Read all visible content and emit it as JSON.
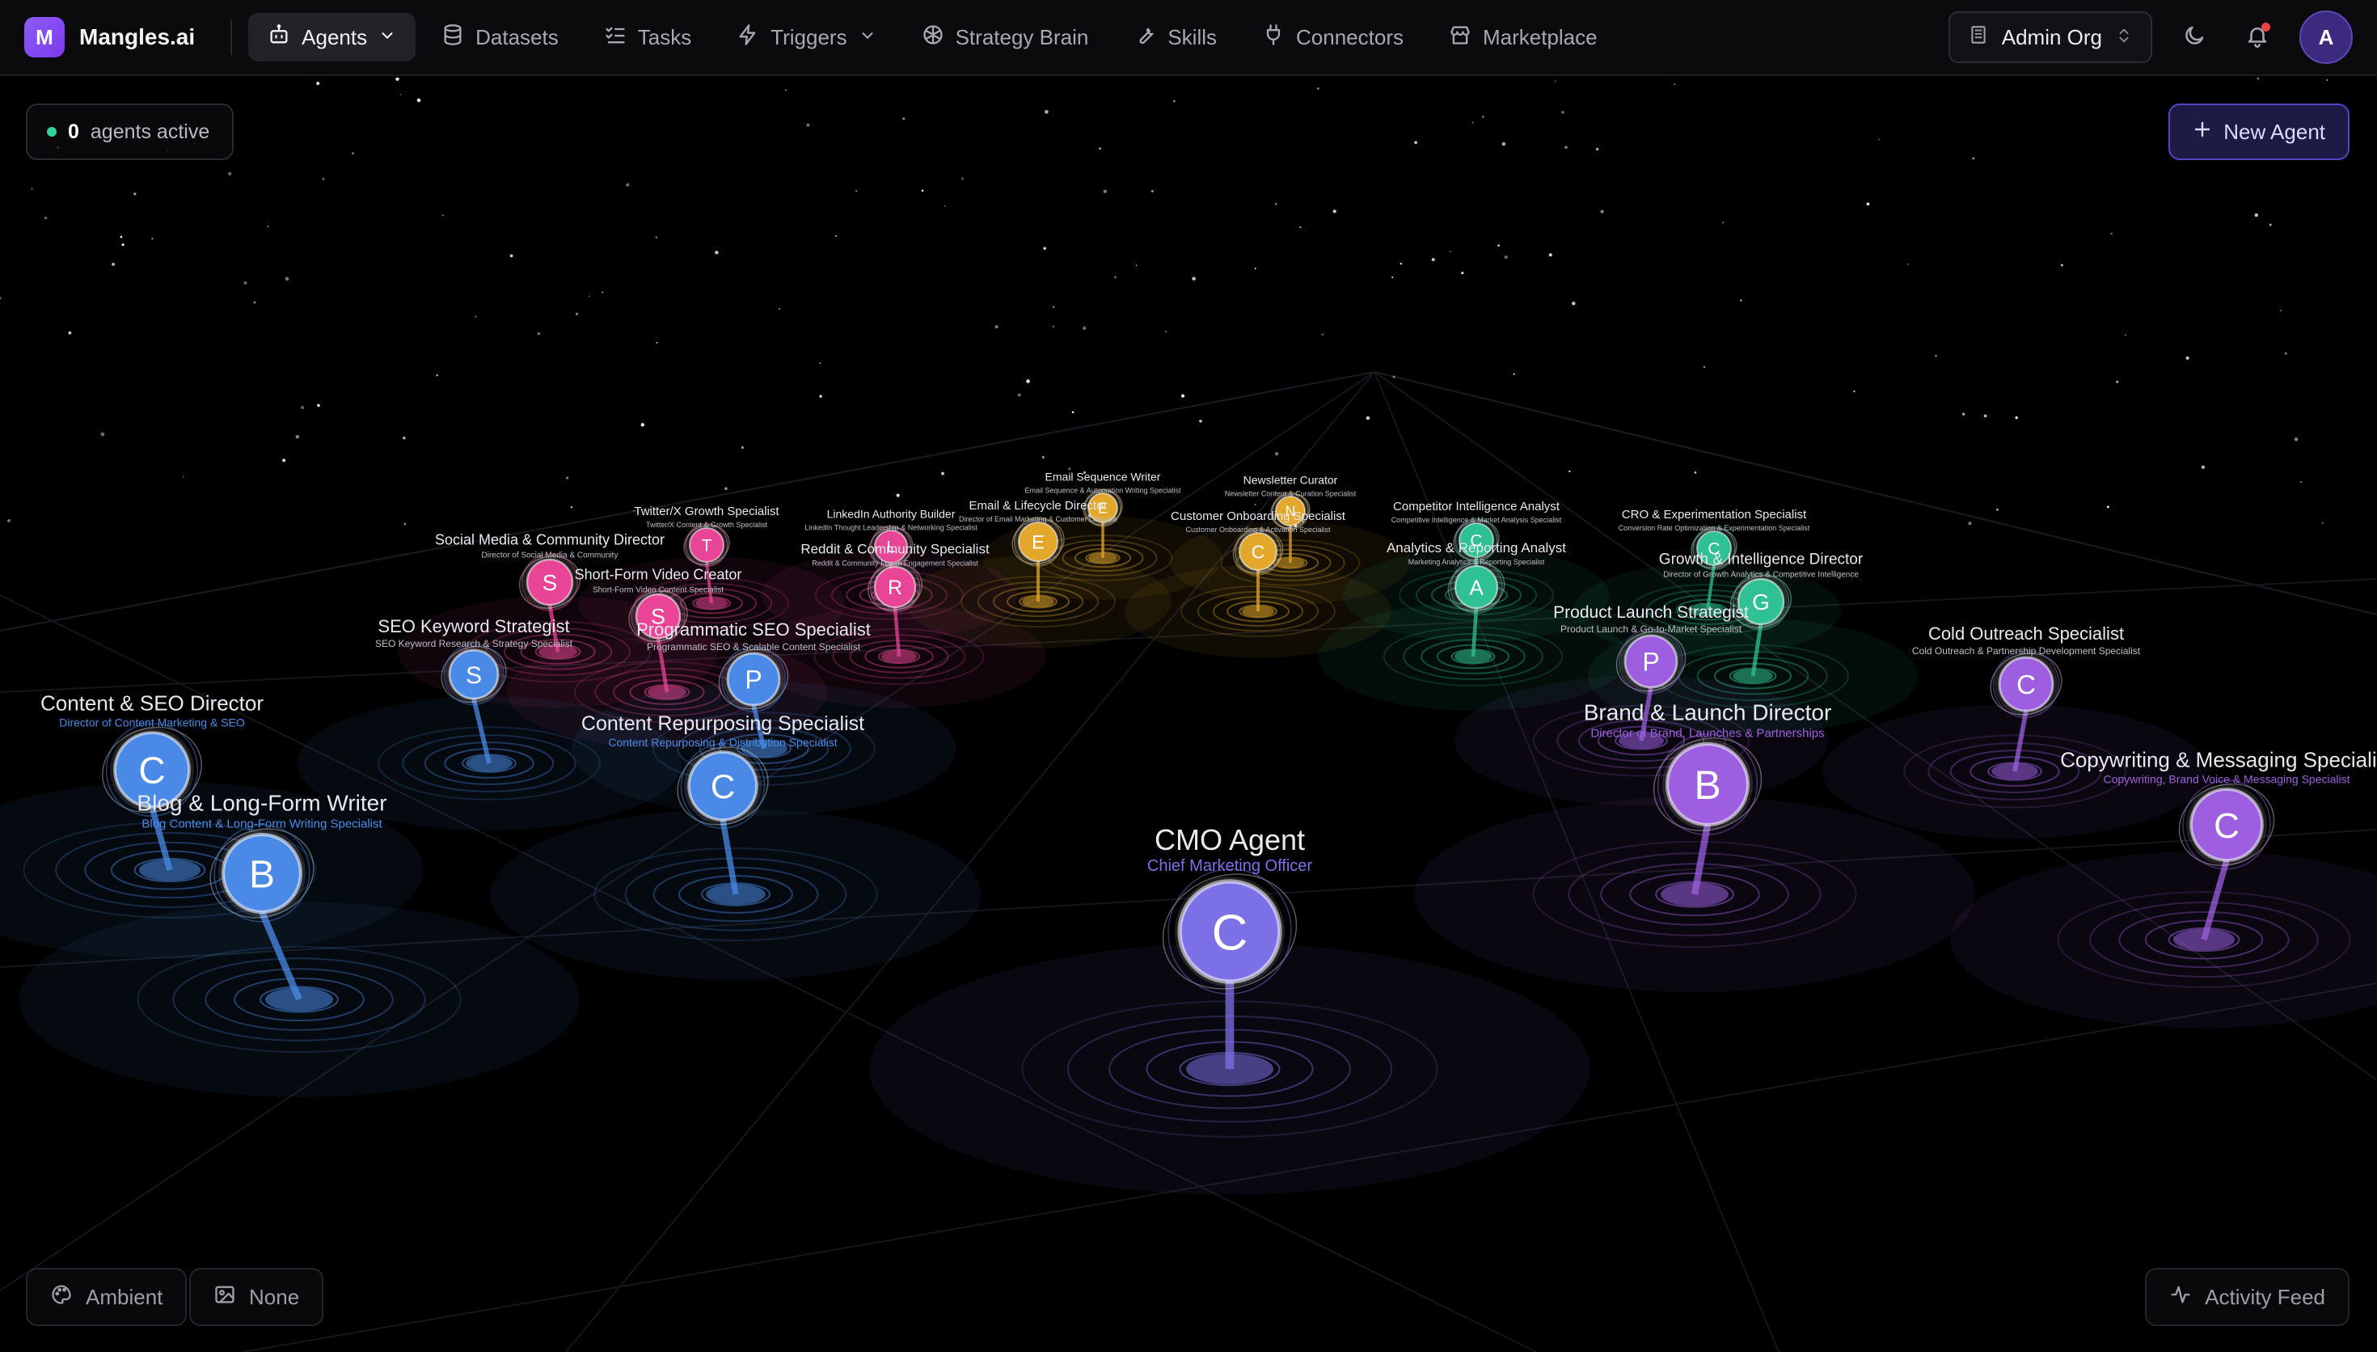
{
  "app": {
    "logo_letter": "M",
    "name": "Mangles.ai"
  },
  "nav": [
    {
      "key": "agents",
      "label": "Agents",
      "icon": "bot-icon",
      "dropdown": true,
      "active": true
    },
    {
      "key": "datasets",
      "label": "Datasets",
      "icon": "database-icon"
    },
    {
      "key": "tasks",
      "label": "Tasks",
      "icon": "list-checks-icon"
    },
    {
      "key": "triggers",
      "label": "Triggers",
      "icon": "zap-icon",
      "dropdown": true
    },
    {
      "key": "strategy-brain",
      "label": "Strategy Brain",
      "icon": "brain-icon"
    },
    {
      "key": "skills",
      "label": "Skills",
      "icon": "wrench-icon"
    },
    {
      "key": "connectors",
      "label": "Connectors",
      "icon": "plug-icon"
    },
    {
      "key": "marketplace",
      "label": "Marketplace",
      "icon": "store-icon"
    }
  ],
  "org": {
    "name": "Admin Org"
  },
  "user": {
    "initial": "A"
  },
  "status": {
    "count": "0",
    "label": "agents active"
  },
  "actions": {
    "new_agent": "New Agent"
  },
  "bottom": {
    "ambient": "Ambient",
    "none": "None",
    "activity_feed": "Activity Feed"
  },
  "colors": {
    "blue": "#4a8ae6",
    "pink": "#e84596",
    "yellow": "#e3a82b",
    "green": "#2fc193",
    "purple": "#9d5fe0",
    "indigo": "#7c70e6"
  },
  "agents": [
    {
      "key": "cmo",
      "letter": "C",
      "name": "CMO Agent",
      "role": "Chief Marketing Officer",
      "color": "indigo"
    },
    {
      "key": "content-seo-director",
      "letter": "C",
      "name": "Content & SEO Director",
      "role": "Director of Content Marketing & SEO",
      "color": "blue"
    },
    {
      "key": "blog-writer",
      "letter": "B",
      "name": "Blog & Long-Form Writer",
      "role": "Blog Content & Long-Form Writing Specialist",
      "color": "blue"
    },
    {
      "key": "seo-keyword",
      "letter": "S",
      "name": "SEO Keyword Strategist",
      "role": "SEO Keyword Research & Strategy Specialist",
      "color": "blue"
    },
    {
      "key": "programmatic-seo",
      "letter": "P",
      "name": "Programmatic SEO Specialist",
      "role": "Programmatic SEO & Scalable Content Specialist",
      "color": "blue"
    },
    {
      "key": "content-repurposing",
      "letter": "C",
      "name": "Content Repurposing Specialist",
      "role": "Content Repurposing & Distribution Specialist",
      "color": "blue"
    },
    {
      "key": "social-director",
      "letter": "S",
      "name": "Social Media & Community Director",
      "role": "Director of Social Media & Community",
      "color": "pink"
    },
    {
      "key": "twitter-growth",
      "letter": "T",
      "name": "Twitter/X Growth Specialist",
      "role": "Twitter/X Content & Growth Specialist",
      "color": "pink"
    },
    {
      "key": "short-form-video",
      "letter": "S",
      "name": "Short-Form Video Creator",
      "role": "Short-Form Video Content Specialist",
      "color": "pink"
    },
    {
      "key": "linkedin-authority",
      "letter": "L",
      "name": "LinkedIn Authority Builder",
      "role": "LinkedIn Thought Leadership & Networking Specialist",
      "color": "pink"
    },
    {
      "key": "reddit-community",
      "letter": "R",
      "name": "Reddit & Community Specialist",
      "role": "Reddit & Community Forum Engagement Specialist",
      "color": "pink"
    },
    {
      "key": "email-lifecycle",
      "letter": "E",
      "name": "Email & Lifecycle Director",
      "role": "Director of Email Marketing & Customer Lifecycle",
      "color": "yellow"
    },
    {
      "key": "email-sequence",
      "letter": "E",
      "name": "Email Sequence Writer",
      "role": "Email Sequence & Automation Writing Specialist",
      "color": "yellow"
    },
    {
      "key": "newsletter-curator",
      "letter": "N",
      "name": "Newsletter Curator",
      "role": "Newsletter Content & Curation Specialist",
      "color": "yellow"
    },
    {
      "key": "customer-onboarding",
      "letter": "C",
      "name": "Customer Onboarding Specialist",
      "role": "Customer Onboarding & Activation Specialist",
      "color": "yellow"
    },
    {
      "key": "competitor-intel",
      "letter": "C",
      "name": "Competitor Intelligence Analyst",
      "role": "Competitive Intelligence & Market Analysis Specialist",
      "color": "green"
    },
    {
      "key": "analytics-reporting",
      "letter": "A",
      "name": "Analytics & Reporting Analyst",
      "role": "Marketing Analytics & Reporting Specialist",
      "color": "green"
    },
    {
      "key": "cro-experimentation",
      "letter": "C",
      "name": "CRO & Experimentation Specialist",
      "role": "Conversion Rate Optimization & Experimentation Specialist",
      "color": "green"
    },
    {
      "key": "growth-intel-director",
      "letter": "G",
      "name": "Growth & Intelligence Director",
      "role": "Director of Growth Analytics & Competitive Intelligence",
      "color": "green"
    },
    {
      "key": "product-launch",
      "letter": "P",
      "name": "Product Launch Strategist",
      "role": "Product Launch & Go-to-Market Specialist",
      "color": "purple"
    },
    {
      "key": "brand-launch-director",
      "letter": "B",
      "name": "Brand & Launch Director",
      "role": "Director of Brand, Launches & Partnerships",
      "color": "purple"
    },
    {
      "key": "cold-outreach",
      "letter": "C",
      "name": "Cold Outreach Specialist",
      "role": "Cold Outreach & Partnership Development Specialist",
      "color": "purple"
    },
    {
      "key": "copywriting",
      "letter": "C",
      "name": "Copywriting & Messaging Specialist",
      "role": "Copywriting, Brand Voice & Messaging Specialist",
      "color": "purple"
    }
  ]
}
